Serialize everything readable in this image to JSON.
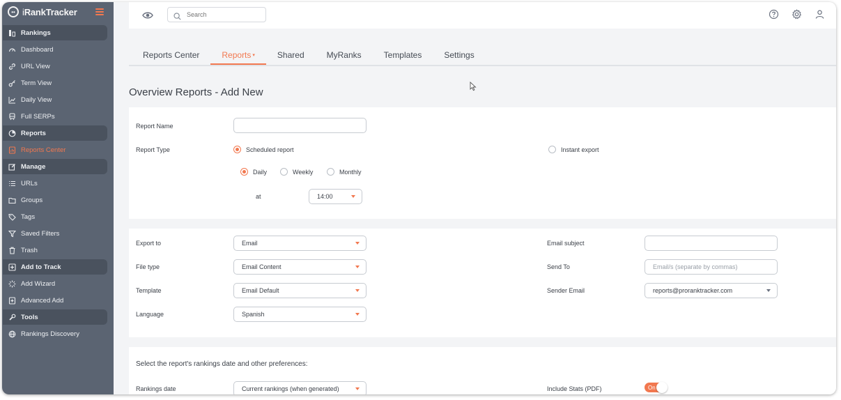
{
  "sidebar": {
    "logo_prefix": "i",
    "logo_brand": "RankTracker",
    "items": [
      {
        "label": "Rankings",
        "icon": "rankings-icon",
        "section": true
      },
      {
        "label": "Dashboard",
        "icon": "dashboard-gauge-icon"
      },
      {
        "label": "URL View",
        "icon": "link-icon"
      },
      {
        "label": "Term View",
        "icon": "key-icon"
      },
      {
        "label": "Daily View",
        "icon": "line-chart-icon"
      },
      {
        "label": "Full SERPs",
        "icon": "train-icon"
      },
      {
        "label": "Reports",
        "icon": "pie-chart-icon",
        "section": true
      },
      {
        "label": "Reports Center",
        "icon": "report-file-icon",
        "active": true
      },
      {
        "label": "Manage",
        "icon": "edit-icon",
        "section": true
      },
      {
        "label": "URLs",
        "icon": "list-icon"
      },
      {
        "label": "Groups",
        "icon": "folder-icon"
      },
      {
        "label": "Tags",
        "icon": "tag-icon"
      },
      {
        "label": "Saved Filters",
        "icon": "filter-icon"
      },
      {
        "label": "Trash",
        "icon": "trash-icon"
      },
      {
        "label": "Add to Track",
        "icon": "plus-square-icon",
        "section": true
      },
      {
        "label": "Add Wizard",
        "icon": "wand-icon"
      },
      {
        "label": "Advanced Add",
        "icon": "plus-box-icon"
      },
      {
        "label": "Tools",
        "icon": "tools-icon",
        "section": true
      },
      {
        "label": "Rankings Discovery",
        "icon": "globe-icon"
      }
    ]
  },
  "topbar": {
    "search_placeholder": "Search"
  },
  "tabs": [
    {
      "label": "Reports Center"
    },
    {
      "label": "Reports",
      "active": true,
      "caret": "▾"
    },
    {
      "label": "Shared"
    },
    {
      "label": "MyRanks"
    },
    {
      "label": "Templates"
    },
    {
      "label": "Settings"
    }
  ],
  "page_title": "Overview Reports - Add New",
  "report_settings": {
    "report_name_label": "Report Name",
    "report_name_value": "",
    "report_type_label": "Report Type",
    "scheduled_label": "Scheduled report",
    "instant_label": "Instant export",
    "daily_label": "Daily",
    "weekly_label": "Weekly",
    "monthly_label": "Monthly",
    "at_label": "at",
    "time_value": "14:00"
  },
  "export": {
    "export_to_label": "Export to",
    "export_to_value": "Email",
    "file_type_label": "File type",
    "file_type_value": "Email Content",
    "template_label": "Template",
    "template_value": "Email Default",
    "language_label": "Language",
    "language_value": "Spanish",
    "email_subject_label": "Email subject",
    "email_subject_value": "",
    "send_to_label": "Send To",
    "send_to_placeholder": "Email/s (separate by commas)",
    "sender_email_label": "Sender Email",
    "sender_email_value": "reports@proranktracker.com"
  },
  "preferences": {
    "intro": "Select the report's rankings date and other preferences:",
    "rankings_date_label": "Rankings date",
    "rankings_date_value": "Current rankings (when generated)",
    "include_stats_label": "Include Stats (PDF)",
    "include_stats_toggle": "On"
  },
  "colors": {
    "accent": "#f2784f",
    "sidebar_bg": "#5b6472",
    "sidebar_section_bg": "#4a525e"
  }
}
